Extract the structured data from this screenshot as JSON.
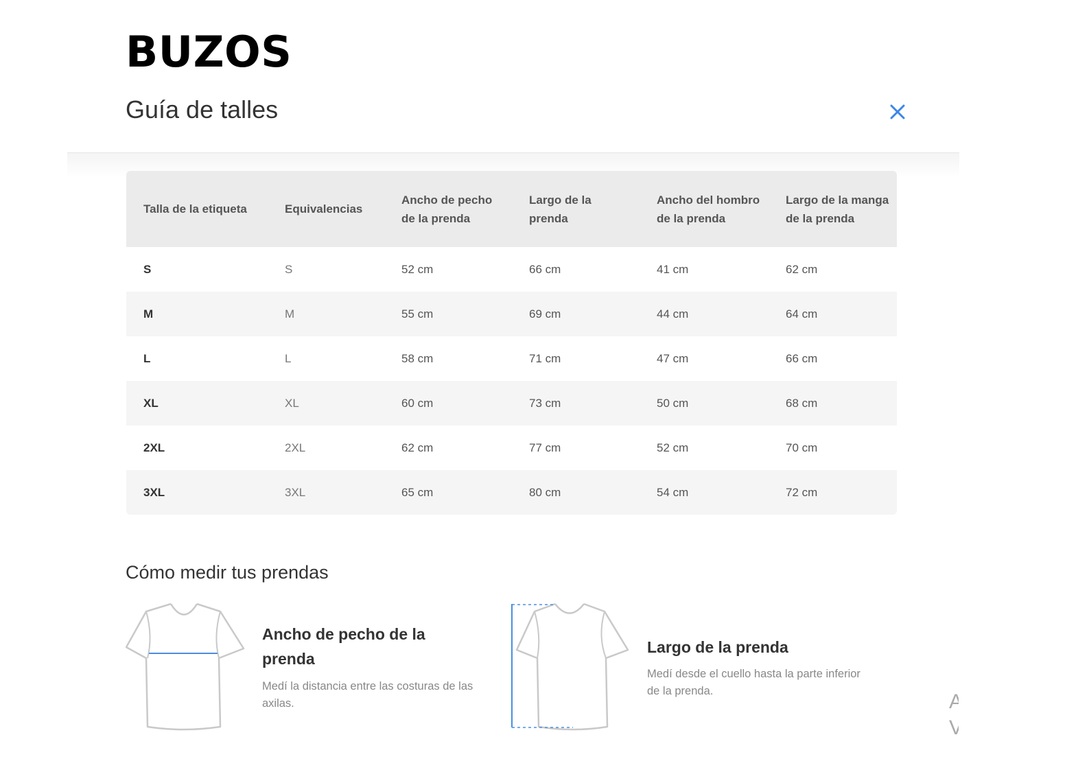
{
  "brand_title": "BUZOS",
  "modal": {
    "title": "Guía de talles",
    "accent_color": "#3a86e8",
    "close_icon": "close-icon"
  },
  "size_table": {
    "headers": [
      "Talla de la etiqueta",
      "Equivalencias",
      "Ancho de pecho de la prenda",
      "Largo de la prenda",
      "Ancho del hombro de la prenda",
      "Largo de la manga de la prenda"
    ],
    "rows": [
      [
        "S",
        "S",
        "52 cm",
        "66 cm",
        "41 cm",
        "62 cm"
      ],
      [
        "M",
        "M",
        "55 cm",
        "69 cm",
        "44 cm",
        "64 cm"
      ],
      [
        "L",
        "L",
        "58 cm",
        "71 cm",
        "47 cm",
        "66 cm"
      ],
      [
        "XL",
        "XL",
        "60 cm",
        "73 cm",
        "50 cm",
        "68 cm"
      ],
      [
        "2XL",
        "2XL",
        "62 cm",
        "77 cm",
        "52 cm",
        "70 cm"
      ],
      [
        "3XL",
        "3XL",
        "65 cm",
        "80 cm",
        "54 cm",
        "72 cm"
      ]
    ]
  },
  "measure_section": {
    "title": "Cómo medir tus prendas",
    "cards": [
      {
        "heading": "Ancho de pecho de la prenda",
        "description": "Medí la distancia entre las costuras de las axilas.",
        "icon": "shirt-chest-width-icon"
      },
      {
        "heading": "Largo de la prenda",
        "description": "Medí desde el cuello hasta la parte inferior de la prenda.",
        "icon": "shirt-length-icon"
      }
    ],
    "partial_next_card_text": "A\nV"
  }
}
